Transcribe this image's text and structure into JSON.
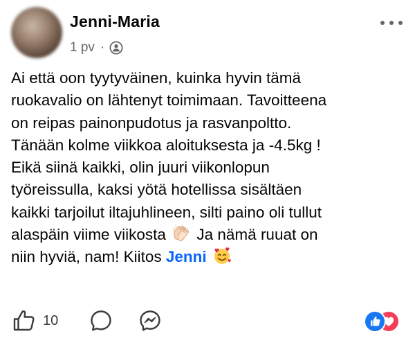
{
  "post": {
    "author": "Jenni-Maria",
    "time": "1 pv",
    "separator": "·",
    "audience_icon": "friends-icon",
    "more_icon": "more-options-icon",
    "body": {
      "l1": "Ai että oon tyytyväinen, kuinka hyvin tämä",
      "l2": "ruokavalio on lähtenyt toimimaan. Tavoitteena",
      "l3": "on reipas painonpudotus ja rasvanpoltto.",
      "l4": "Tänään kolme viikkoa aloituksesta ja -4.5kg !",
      "l5": "Eikä siinä kaikki, olin juuri viikonlopun",
      "l6": "työreissulla, kaksi yötä hotellissa sisältäen",
      "l7": "kaikki tarjoilut iltajuhlineen, silti paino oli tullut",
      "l8_a": "alaspäin viime viikosta",
      "l8_b": "Ja nämä ruuat on",
      "l9_a": "niin hyviä, nam! Kiitos",
      "mention": "Jenni",
      "emoji_clap": "clapping-hands-emoji",
      "emoji_hearts": "smiling-face-with-hearts-emoji"
    }
  },
  "footer": {
    "like_icon": "like-icon",
    "like_count": "10",
    "comment_icon": "comment-icon",
    "share_icon": "messenger-share-icon",
    "reactions": [
      "like",
      "love"
    ]
  },
  "colors": {
    "mention": "#0866ff",
    "meta": "#65676b",
    "like_reaction": "#1877f2",
    "love_reaction": "#f33e58"
  }
}
